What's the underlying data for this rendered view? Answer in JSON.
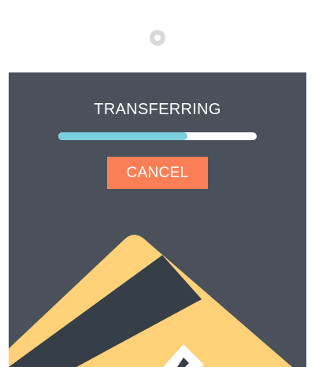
{
  "transfer": {
    "title": "TRANSFERRING",
    "progress": 0.65,
    "cancel_label": "CANCEL"
  },
  "colors": {
    "screen_bg": "#4a515b",
    "progress_fill": "#7ccfdc",
    "progress_track": "#ffffff",
    "cancel_bg": "#fb7f56",
    "card_yellow": "#ffd179",
    "card_stripe": "#363e47",
    "camera_dot": "#d9d9d9"
  },
  "illustration": {
    "icon": "credit-card-icon"
  }
}
